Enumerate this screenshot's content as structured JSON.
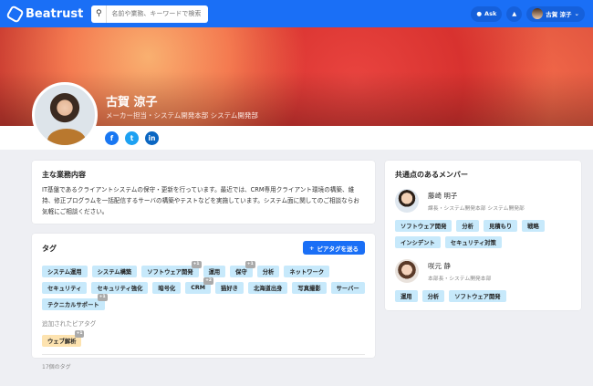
{
  "header": {
    "brand": "Beatrust",
    "search_placeholder": "名前や業務、キーワードで検索",
    "ask_label": "Ask",
    "user_name": "古賀 涼子"
  },
  "profile": {
    "name": "古賀 涼子",
    "role": "メーカー担当・システム開発本部 システム開発部",
    "social": [
      "f",
      "t",
      "in"
    ]
  },
  "duties": {
    "title": "主な業務内容",
    "text": "IT基盤であるクライアントシステムの保守・更新を行っています。最近では、CRM専用クライアント環境の構築、維持、修正プログラムを一括配信するサーバの構築やテストなどを実施しています。システム面に関してのご相談ならお気軽にご相談ください。"
  },
  "tags": {
    "title": "タグ",
    "send_button": "ピアタグを送る",
    "items": [
      {
        "label": "システム運用"
      },
      {
        "label": "システム構築"
      },
      {
        "label": "ソフトウェア開発",
        "badge": "+1"
      },
      {
        "label": "運用"
      },
      {
        "label": "保守",
        "badge": "+1"
      },
      {
        "label": "分析"
      },
      {
        "label": "ネットワーク"
      },
      {
        "label": "セキュリティ"
      },
      {
        "label": "セキュリティ強化"
      },
      {
        "label": "暗号化"
      },
      {
        "label": "CRM",
        "badge": "+2"
      },
      {
        "label": "猫好き"
      },
      {
        "label": "北海道出身"
      },
      {
        "label": "写真撮影"
      },
      {
        "label": "サーバー"
      },
      {
        "label": "テクニカルサポート",
        "badge": "+1"
      }
    ],
    "peer_title": "追加されたピアタグ",
    "peer_items": [
      {
        "label": "ウェブ解析",
        "badge": "+1"
      }
    ],
    "count": "17個のタグ"
  },
  "members": {
    "title": "共通点のあるメンバー",
    "list": [
      {
        "name": "藤崎 明子",
        "role": "課長・システム開発本部 システム開発部",
        "tags": [
          "ソフトウェア開発",
          "分析",
          "見積もり",
          "戦略",
          "インシデント",
          "セキュリティ対策"
        ]
      },
      {
        "name": "咲元 静",
        "role": "本部長・システム開発本部",
        "tags": [
          "運用",
          "分析",
          "ソフトウェア開発"
        ]
      }
    ]
  },
  "colors": {
    "primary": "#1a6ff6",
    "tag": "#c7e9fb",
    "peer_tag": "#fde3b0"
  }
}
